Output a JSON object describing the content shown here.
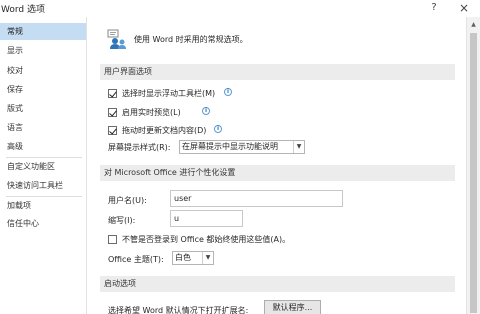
{
  "window": {
    "title": "Word 选项",
    "help_label": "?",
    "close_label": "×"
  },
  "sidebar": {
    "items": [
      {
        "label": "常规"
      },
      {
        "label": "显示"
      },
      {
        "label": "校对"
      },
      {
        "label": "保存"
      },
      {
        "label": "版式"
      },
      {
        "label": "语言"
      },
      {
        "label": "高级"
      },
      {
        "label": "自定义功能区"
      },
      {
        "label": "快速访问工具栏"
      },
      {
        "label": "加载项"
      },
      {
        "label": "信任中心"
      }
    ],
    "selected_index": 0
  },
  "intro": {
    "text": "使用 Word 时采用的常规选项。"
  },
  "sections": {
    "ui": {
      "header": "用户界面选项",
      "options": [
        {
          "label": "选择时显示浮动工具栏(M)",
          "checked": true
        },
        {
          "label": "启用实时预览(L)",
          "checked": true
        },
        {
          "label": "拖动时更新文档内容(D)",
          "checked": true
        }
      ],
      "screentip_label": "屏幕提示样式(R):",
      "screentip_value": "在屏幕提示中显示功能说明"
    },
    "personalize": {
      "header": "对 Microsoft Office 进行个性化设置",
      "username_label": "用户名(U):",
      "username_value": "user",
      "initials_label": "缩写(I):",
      "initials_value": "u",
      "always_use_label": "不管是否登录到 Office 都始终使用这些值(A)。",
      "always_use_checked": false,
      "theme_label": "Office 主题(T):",
      "theme_value": "白色"
    },
    "startup": {
      "header": "启动选项",
      "default_programs_label": "选择希望 Word 默认情况下打开扩展名:",
      "default_programs_button": "默认程序..."
    }
  },
  "colors": {
    "selected_nav": "#c5ddf3",
    "section_header": "#ececec",
    "info_icon": "#2e75b6"
  }
}
